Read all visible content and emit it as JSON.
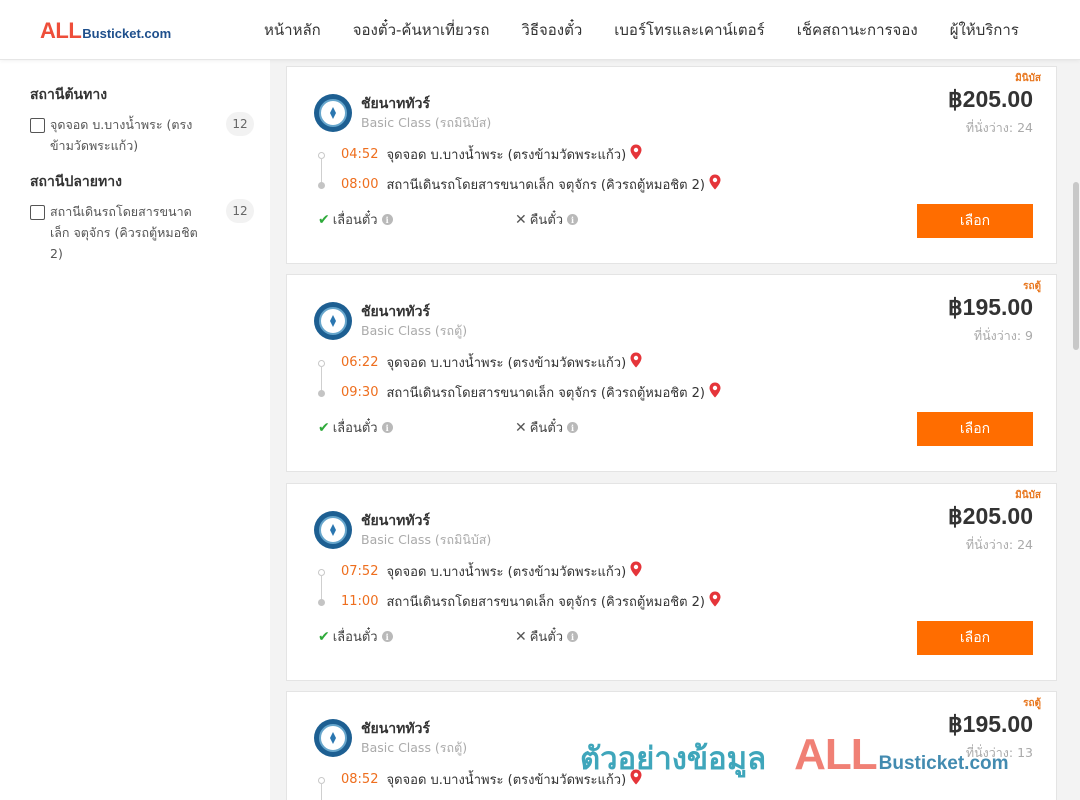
{
  "header": {
    "logo_all": "ALL",
    "logo_rest": "Busticket.com",
    "nav": [
      "หน้าหลัก",
      "จองตั๋ว-ค้นหาเที่ยวรถ",
      "วิธีจองตั๋ว",
      "เบอร์โทรและเคาน์เตอร์",
      "เช็คสถานะการจอง",
      "ผู้ให้บริการ"
    ]
  },
  "sidebar": {
    "origin_title": "สถานีต้นทาง",
    "origin_label": "จุดจอด บ.บางน้ำพระ (ตรงข้ามวัดพระแก้ว)",
    "origin_count": "12",
    "dest_title": "สถานีปลายทาง",
    "dest_label": "สถานีเดินรถโดยสารขนาดเล็ก จตุจักร (คิวรถตู้หมอชิต 2)",
    "dest_count": "12"
  },
  "trips": [
    {
      "tag": "มินิบัส",
      "operator": "ชัยนาททัวร์",
      "class": "Basic Class (รถมินิบัส)",
      "price": "฿205.00",
      "seats": "ที่นั่งว่าง: 24",
      "dep_time": "04:52",
      "dep_stop": "จุดจอด บ.บางน้ำพระ (ตรงข้ามวัดพระแก้ว)",
      "arr_time": "08:00",
      "arr_stop": "สถานีเดินรถโดยสารขนาดเล็ก จตุจักร (คิวรถตู้หมอชิต 2)",
      "change": "เลื่อนตั๋ว",
      "refund": "คืนตั๋ว",
      "select": "เลือก"
    },
    {
      "tag": "รถตู้",
      "operator": "ชัยนาททัวร์",
      "class": "Basic Class (รถตู้)",
      "price": "฿195.00",
      "seats": "ที่นั่งว่าง: 9",
      "dep_time": "06:22",
      "dep_stop": "จุดจอด บ.บางน้ำพระ (ตรงข้ามวัดพระแก้ว)",
      "arr_time": "09:30",
      "arr_stop": "สถานีเดินรถโดยสารขนาดเล็ก จตุจักร (คิวรถตู้หมอชิต 2)",
      "change": "เลื่อนตั๋ว",
      "refund": "คืนตั๋ว",
      "select": "เลือก"
    },
    {
      "tag": "มินิบัส",
      "operator": "ชัยนาททัวร์",
      "class": "Basic Class (รถมินิบัส)",
      "price": "฿205.00",
      "seats": "ที่นั่งว่าง: 24",
      "dep_time": "07:52",
      "dep_stop": "จุดจอด บ.บางน้ำพระ (ตรงข้ามวัดพระแก้ว)",
      "arr_time": "11:00",
      "arr_stop": "สถานีเดินรถโดยสารขนาดเล็ก จตุจักร (คิวรถตู้หมอชิต 2)",
      "change": "เลื่อนตั๋ว",
      "refund": "คืนตั๋ว",
      "select": "เลือก"
    },
    {
      "tag": "รถตู้",
      "operator": "ชัยนาททัวร์",
      "class": "Basic Class (รถตู้)",
      "price": "฿195.00",
      "seats": "ที่นั่งว่าง: 13",
      "dep_time": "08:52",
      "dep_stop": "จุดจอด บ.บางน้ำพระ (ตรงข้ามวัดพระแก้ว)",
      "arr_time": "",
      "arr_stop": "",
      "change": "",
      "refund": "",
      "select": ""
    }
  ],
  "watermark": {
    "text": "ตัวอย่างข้อมูล",
    "logo_all": "ALL",
    "logo_rest": "Busticket.com"
  },
  "colors": {
    "accent": "#ff6d00",
    "time": "#ee6e1e",
    "tag": "#e8771f",
    "check": "#2eaa3a",
    "pin": "#e5353a"
  }
}
